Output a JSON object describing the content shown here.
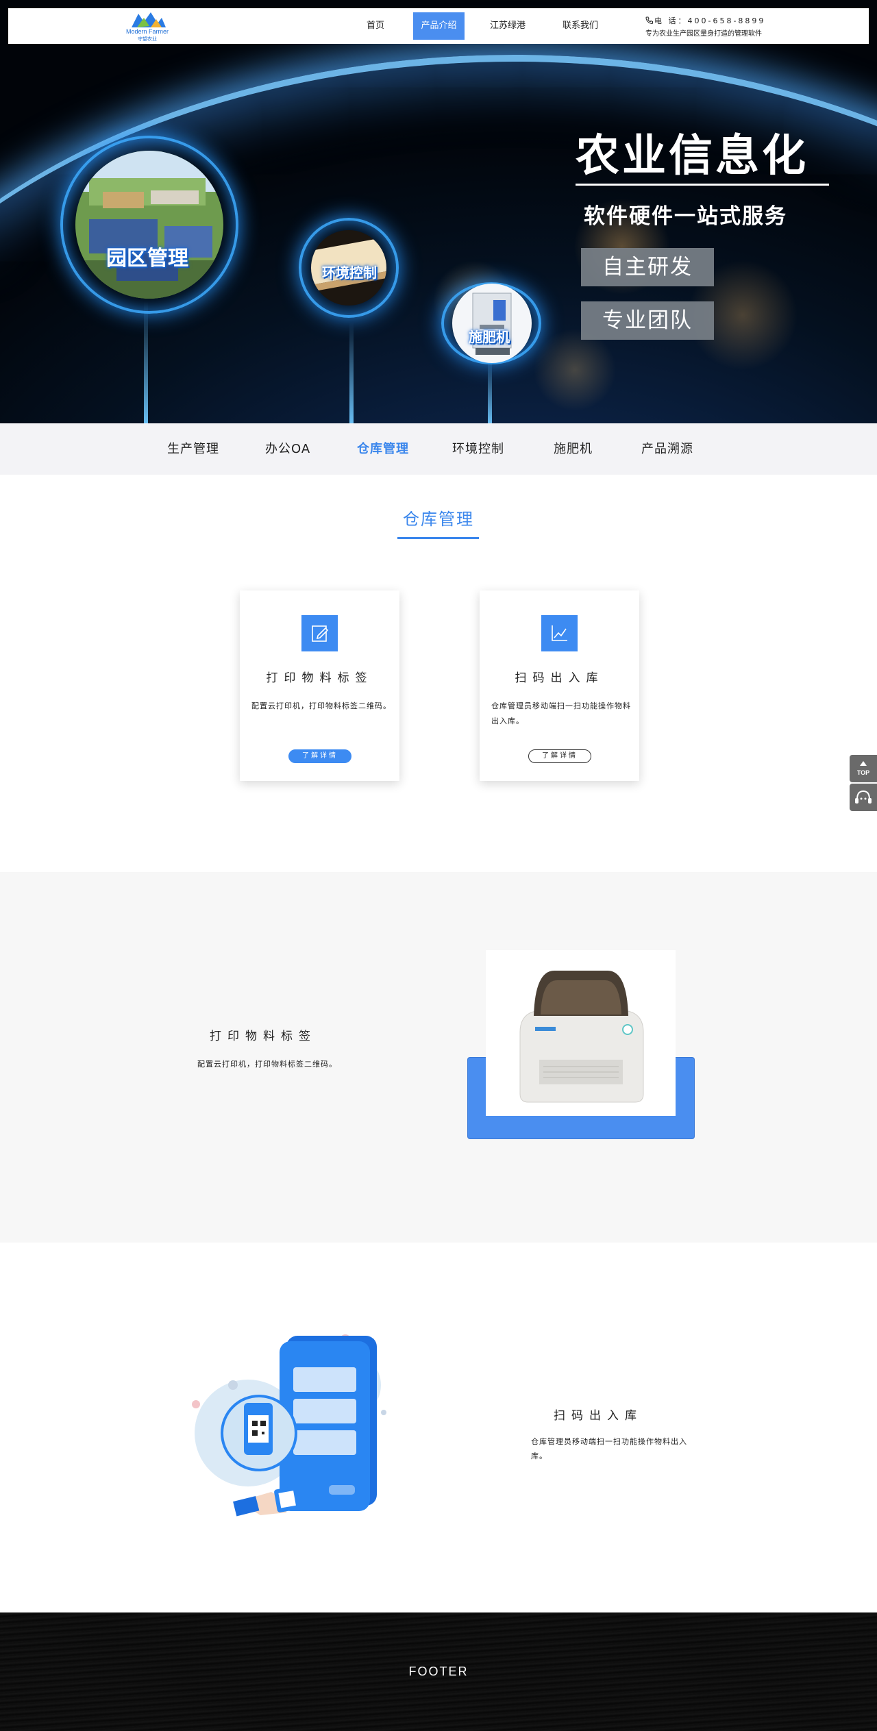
{
  "header": {
    "logo_text": "Modern Farmer",
    "logo_sub": "守望农业",
    "nav": [
      {
        "label": "首页"
      },
      {
        "label": "产品介绍"
      },
      {
        "label": "江苏绿港"
      },
      {
        "label": "联系我们"
      }
    ],
    "phone": "电 话：400-658-8899",
    "slogan": "专为农业生产园区量身打造的管理软件"
  },
  "hero": {
    "title": "农业信息化",
    "subtitle": "软件硬件一站式服务",
    "tags": [
      "自主研发",
      "专业团队"
    ],
    "circles": [
      {
        "label": "园区管理"
      },
      {
        "label": "环境控制"
      },
      {
        "label": "施肥机"
      }
    ]
  },
  "subnav": {
    "items": [
      {
        "label": "生产管理"
      },
      {
        "label": "办公OA"
      },
      {
        "label": "仓库管理"
      },
      {
        "label": "环境控制"
      },
      {
        "label": "施肥机"
      },
      {
        "label": "产品溯源"
      }
    ]
  },
  "section": {
    "title": "仓库管理"
  },
  "cards": [
    {
      "icon": "edit-icon",
      "title": "打印物料标签",
      "desc": "配置云打印机，打印物料标签二维码。",
      "button": "了解详情"
    },
    {
      "icon": "chart-line-icon",
      "title": "扫码出入库",
      "desc": "仓库管理员移动端扫一扫功能操作物料出入库。",
      "button": "了解详情"
    }
  ],
  "feature1": {
    "title": "打印物料标签",
    "desc": "配置云打印机，打印物料标签二维码。"
  },
  "feature2": {
    "title": "扫码出入库",
    "desc": "仓库管理员移动端扫一扫功能操作物料出入库。"
  },
  "footer": {
    "text": "FOOTER"
  },
  "float": {
    "top_label": "TOP"
  },
  "colors": {
    "accent": "#3a86ec",
    "nav_active": "#4a8ef0"
  }
}
